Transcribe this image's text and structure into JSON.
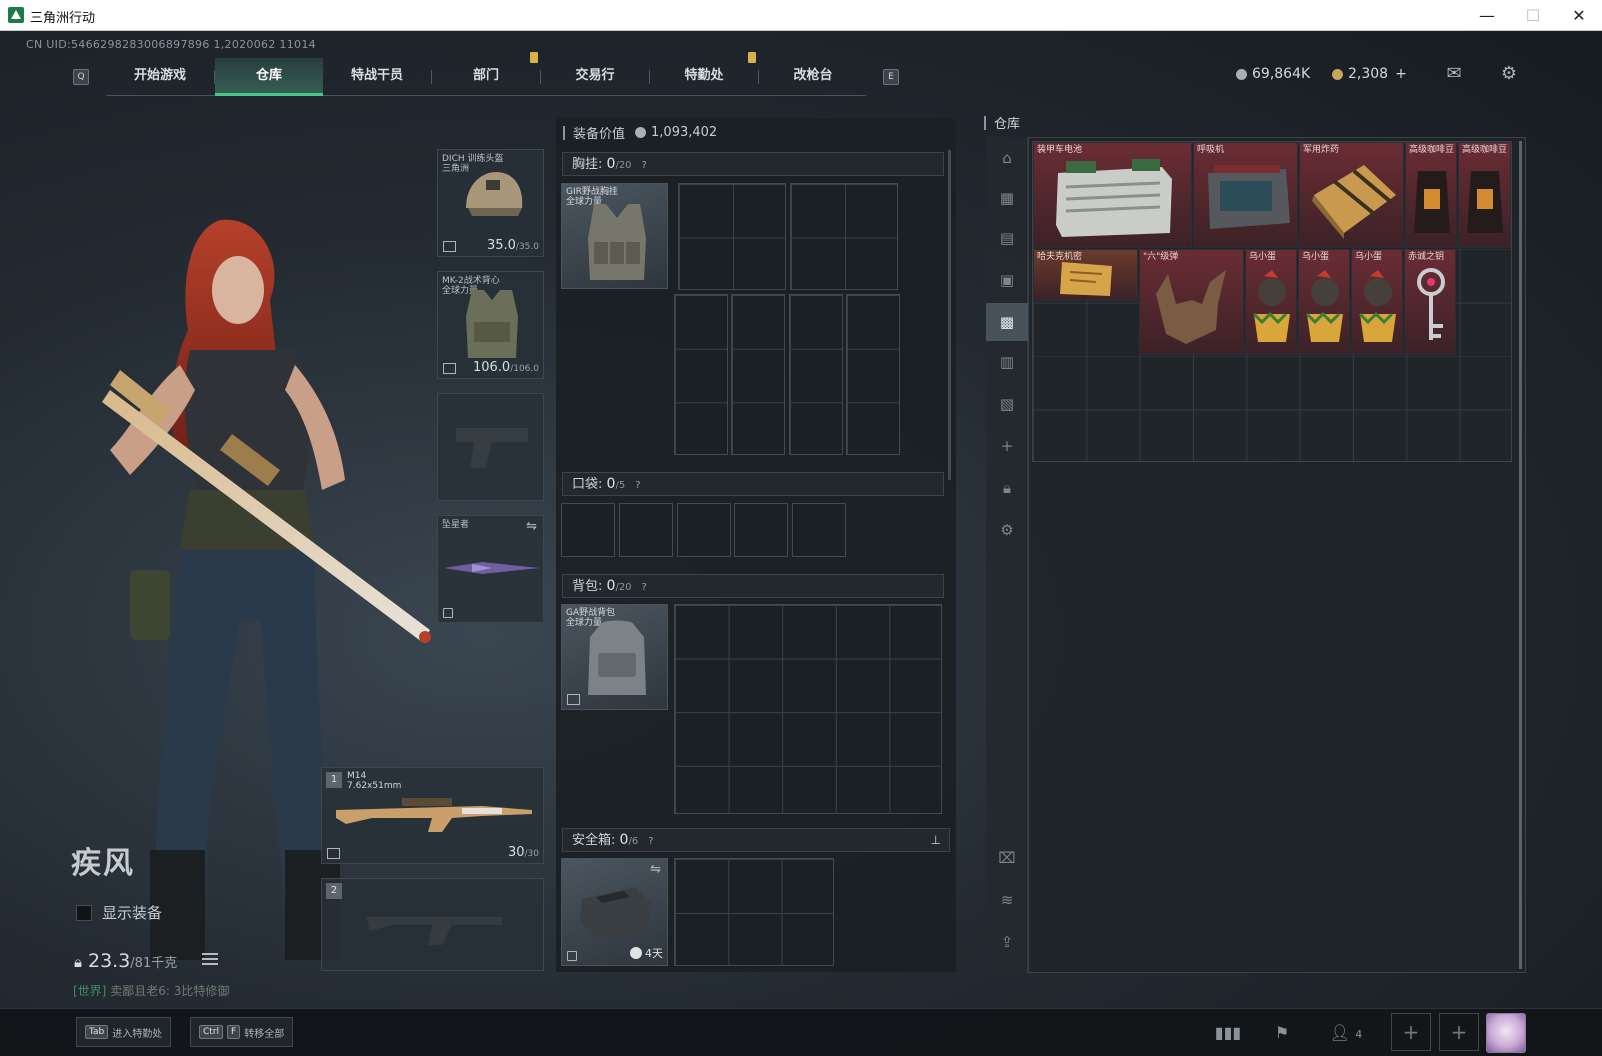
{
  "window": {
    "title": "三角洲行动",
    "min": "—",
    "max": "☐",
    "close": "✕"
  },
  "uid": "CN UID:5466298283006897896 1,2020062 11014",
  "nav": {
    "left_key": "Q",
    "right_key": "E",
    "tabs": [
      "开始游戏",
      "仓库",
      "特战干员",
      "部门",
      "交易行",
      "特勤处",
      "改枪台"
    ],
    "active_index": 1
  },
  "currency": {
    "silver": "69,864K",
    "gold": "2,308",
    "add": "+"
  },
  "operator": {
    "name": "疾风",
    "show_gear_label": "显示装备",
    "weight": "23.3",
    "weight_max": "/81千克",
    "chat_tag": "[世界]",
    "chat_text": "卖鄙且老6: 3比特修御"
  },
  "slots": {
    "helmet": {
      "name1": "DICH 训练头盔",
      "name2": "三角洲",
      "dur": "35.0",
      "max": "/35.0"
    },
    "armor": {
      "name1": "MK-2战术背心",
      "name2": "全球力量",
      "dur": "106.0",
      "max": "/106.0"
    },
    "melee": {
      "name": "坠星者"
    },
    "primary": {
      "num": "1",
      "name": "M14",
      "caliber": "7.62x51mm",
      "ammo": "30",
      "ammo_max": "/30"
    },
    "secondary": {
      "num": "2"
    }
  },
  "loadout": {
    "value_label": "装备价值",
    "value": "1,093,402",
    "chest": {
      "label": "胸挂:",
      "count": "0",
      "cap": "/20",
      "help": "?",
      "item1": "GIR野战胸挂",
      "item2": "全球力量"
    },
    "pocket": {
      "label": "口袋:",
      "count": "0",
      "cap": "/5",
      "help": "?"
    },
    "backpack": {
      "label": "背包:",
      "count": "0",
      "cap": "/20",
      "help": "?",
      "item1": "GA野战背包",
      "item2": "全球力量"
    },
    "safebox": {
      "label": "安全箱:",
      "count": "0",
      "cap": "/6",
      "help": "?",
      "timer": "4天"
    }
  },
  "stash": {
    "title": "仓库",
    "items": [
      {
        "name": "装甲车电池",
        "color": "#6b2c34"
      },
      {
        "name": "呼吸机",
        "color": "#6b2c34"
      },
      {
        "name": "军用炸药",
        "color": "#6b2c34"
      },
      {
        "name": "高级咖啡豆",
        "color": "#6b2c34"
      },
      {
        "name": "高级咖啡豆",
        "color": "#6b2c34"
      },
      {
        "name": "哈夫克机密",
        "color": "#6b3a2c"
      },
      {
        "name": "\"六\"级弹",
        "color": "#6b2c34"
      },
      {
        "name": "乌小蛋",
        "color": "#6b2c34"
      },
      {
        "name": "乌小蛋",
        "color": "#6b2c34"
      },
      {
        "name": "乌小蛋",
        "color": "#6b2c34"
      },
      {
        "name": "赤诚之钥",
        "color": "#6b2c34"
      }
    ]
  },
  "bottom": {
    "btn1_key": "Tab",
    "btn1_label": "进入特勤处",
    "btn2_key1": "Ctrl",
    "btn2_key2": "F",
    "btn2_label": "转移全部",
    "squad_count": "4"
  },
  "colors": {
    "accent": "#48c98c",
    "rare_red": "#6b2c34",
    "gold_mark": "#d8b14a"
  }
}
